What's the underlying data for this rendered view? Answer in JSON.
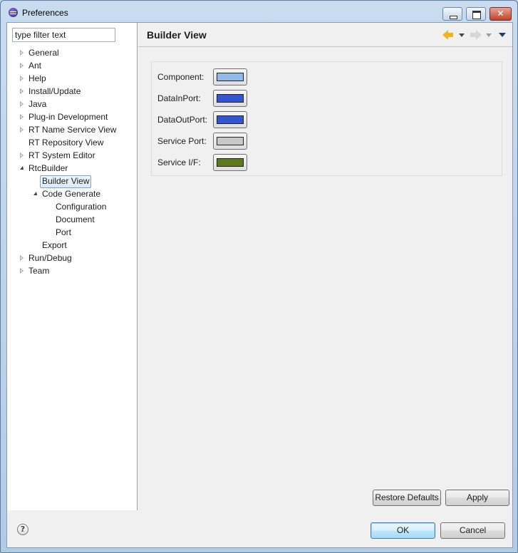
{
  "window": {
    "title": "Preferences"
  },
  "filter": {
    "placeholder": "type filter text",
    "value": "type filter text"
  },
  "tree": {
    "items": [
      {
        "label": "General",
        "state": "collapsed"
      },
      {
        "label": "Ant",
        "state": "collapsed"
      },
      {
        "label": "Help",
        "state": "collapsed"
      },
      {
        "label": "Install/Update",
        "state": "collapsed"
      },
      {
        "label": "Java",
        "state": "collapsed"
      },
      {
        "label": "Plug-in Development",
        "state": "collapsed"
      },
      {
        "label": "RT Name Service View",
        "state": "collapsed"
      },
      {
        "label": "RT Repository View",
        "state": "leaf"
      },
      {
        "label": "RT System Editor",
        "state": "collapsed"
      },
      {
        "label": "RtcBuilder",
        "state": "expanded"
      },
      {
        "label": "Builder View",
        "state": "leaf",
        "selected": true
      },
      {
        "label": "Code Generate",
        "state": "expanded"
      },
      {
        "label": "Configuration",
        "state": "leaf"
      },
      {
        "label": "Document",
        "state": "leaf"
      },
      {
        "label": "Port",
        "state": "leaf"
      },
      {
        "label": "Export",
        "state": "leaf"
      },
      {
        "label": "Run/Debug",
        "state": "collapsed"
      },
      {
        "label": "Team",
        "state": "collapsed"
      }
    ]
  },
  "page": {
    "title": "Builder View",
    "colors": [
      {
        "label": "Component:",
        "color": "#8fbaea"
      },
      {
        "label": "DataInPort:",
        "color": "#3255d4"
      },
      {
        "label": "DataOutPort:",
        "color": "#3255d4"
      },
      {
        "label": "Service Port:",
        "color": "#c8c8c8"
      },
      {
        "label": "Service I/F:",
        "color": "#5d7a1a"
      }
    ],
    "restore_defaults_label": "Restore Defaults",
    "apply_label": "Apply"
  },
  "nav": {
    "back_icon": "arrow-left-icon",
    "forward_icon": "arrow-right-icon",
    "menu_icon": "view-menu-icon"
  },
  "footer": {
    "help_icon": "help-icon",
    "help_glyph": "?",
    "ok_label": "OK",
    "cancel_label": "Cancel"
  }
}
